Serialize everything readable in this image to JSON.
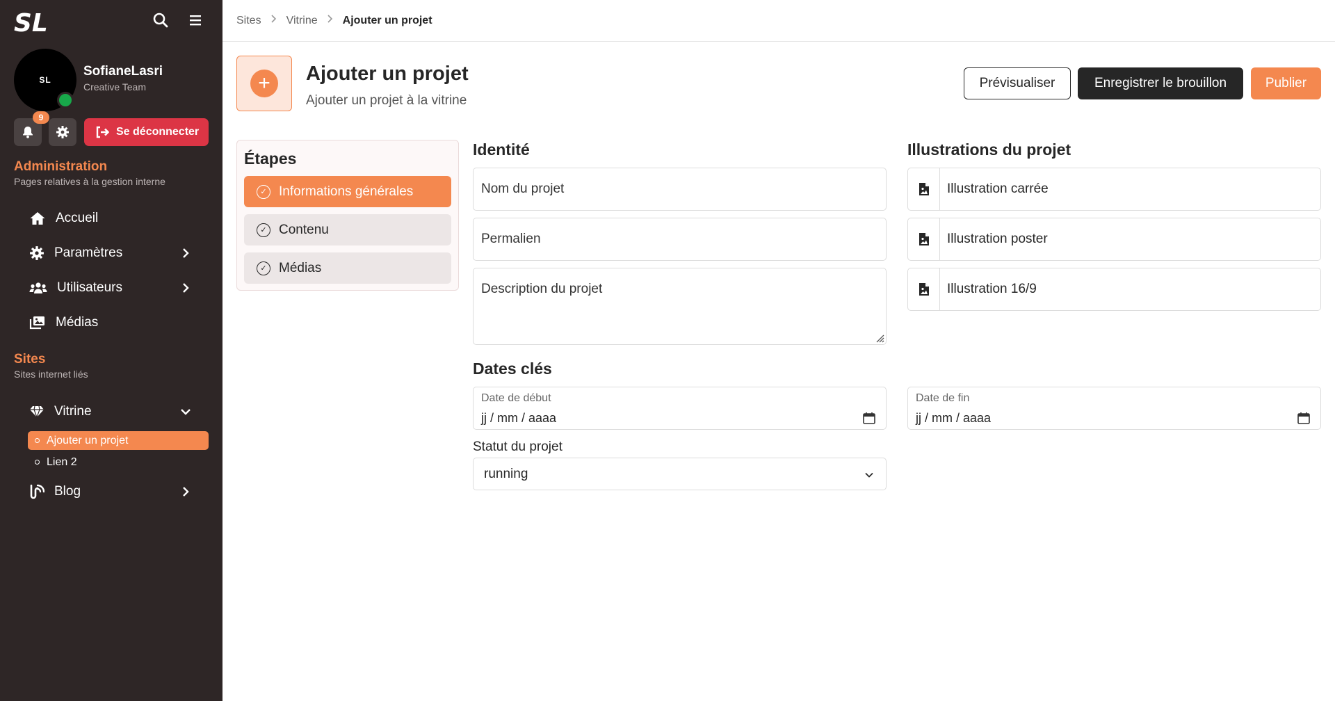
{
  "sidebar": {
    "logo_text": "SL",
    "avatar_text": "SL",
    "user_name": "SofianeLasri",
    "user_team": "Creative Team",
    "notification_count": "9",
    "logout_label": "Se déconnecter",
    "admin_section": {
      "title": "Administration",
      "subtitle": "Pages relatives à la gestion interne"
    },
    "admin_items": [
      {
        "label": "Accueil",
        "icon": "home-icon"
      },
      {
        "label": "Paramètres",
        "icon": "gear-icon"
      },
      {
        "label": "Utilisateurs",
        "icon": "users-icon"
      },
      {
        "label": "Médias",
        "icon": "images-icon"
      }
    ],
    "sites_section": {
      "title": "Sites",
      "subtitle": "Sites internet liés"
    },
    "vitrine_label": "Vitrine",
    "vitrine_sub_items": [
      "Ajouter un projet",
      "Lien 2"
    ],
    "blog_label": "Blog"
  },
  "breadcrumb": [
    "Sites",
    "Vitrine",
    "Ajouter un projet"
  ],
  "header": {
    "title": "Ajouter un projet",
    "subtitle": "Ajouter un projet à la vitrine",
    "preview_label": "Prévisualiser",
    "save_draft_label": "Enregistrer le brouillon",
    "publish_label": "Publier"
  },
  "steps": {
    "title": "Étapes",
    "items": [
      "Informations générales",
      "Contenu",
      "Médias"
    ]
  },
  "identity": {
    "title": "Identité",
    "name_placeholder": "Nom du projet",
    "permalink_placeholder": "Permalien",
    "description_placeholder": "Description du projet"
  },
  "illustrations": {
    "title": "Illustrations du projet",
    "items": [
      "Illustration carrée",
      "Illustration poster",
      "Illustration 16/9"
    ]
  },
  "dates": {
    "title": "Dates clés",
    "start_label": "Date de début",
    "start_value": "jj / mm / aaaa",
    "end_label": "Date de fin",
    "end_value": "jj / mm / aaaa"
  },
  "status": {
    "label": "Statut du projet",
    "value": "running"
  },
  "colors": {
    "accent": "#f4884f",
    "sidebar_bg": "#2e2626",
    "danger": "#dc3545",
    "online": "#18a84a"
  }
}
